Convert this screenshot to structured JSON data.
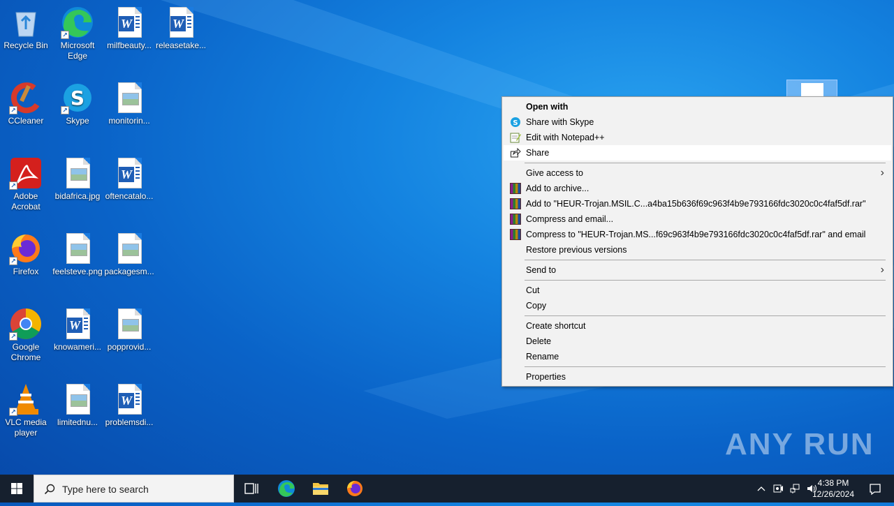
{
  "desktop": {
    "icons": [
      {
        "label": "Recycle Bin",
        "kind": "recycle"
      },
      {
        "label": "Microsoft Edge",
        "kind": "edge"
      },
      {
        "label": "milfbeauty...",
        "kind": "word"
      },
      {
        "label": "releasetake...",
        "kind": "word"
      },
      {
        "label": "CCleaner",
        "kind": "ccleaner"
      },
      {
        "label": "Skype",
        "kind": "skype"
      },
      {
        "label": "monitorin...",
        "kind": "image"
      },
      {
        "label": "Adobe Acrobat",
        "kind": "acrobat"
      },
      {
        "label": "bidafrica.jpg",
        "kind": "image"
      },
      {
        "label": "oftencatalo...",
        "kind": "word"
      },
      {
        "label": "Firefox",
        "kind": "firefox"
      },
      {
        "label": "feelsteve.png",
        "kind": "image"
      },
      {
        "label": "packagesm...",
        "kind": "image"
      },
      {
        "label": "Google Chrome",
        "kind": "chrome"
      },
      {
        "label": "knowameri...",
        "kind": "word"
      },
      {
        "label": "popprovid...",
        "kind": "image"
      },
      {
        "label": "VLC media player",
        "kind": "vlc"
      },
      {
        "label": "limitednu...",
        "kind": "image"
      },
      {
        "label": "problemsdi...",
        "kind": "word"
      }
    ]
  },
  "context_menu": {
    "open_with": "Open with",
    "share_skype": "Share with Skype",
    "edit_notepad": "Edit with Notepad++",
    "share": "Share",
    "give_access": "Give access to",
    "add_archive": "Add to archive...",
    "add_to_rar": "Add to \"HEUR-Trojan.MSIL.C...a4ba15b636f69c963f4b9e793166fdc3020c0c4faf5df.rar\"",
    "compress_email": "Compress and email...",
    "compress_to_rar_email": "Compress to \"HEUR-Trojan.MS...f69c963f4b9e793166fdc3020c0c4faf5df.rar\" and email",
    "restore": "Restore previous versions",
    "send_to": "Send to",
    "cut": "Cut",
    "copy": "Copy",
    "create_shortcut": "Create shortcut",
    "delete": "Delete",
    "rename": "Rename",
    "properties": "Properties"
  },
  "watermark": "ANY RUN",
  "taskbar": {
    "search_placeholder": "Type here to search",
    "time": "4:38 PM",
    "date": "12/26/2024"
  },
  "colors": {
    "menu_bg": "#f2f2f2",
    "taskbar": "#16202e",
    "accent": "#1a7be0"
  }
}
